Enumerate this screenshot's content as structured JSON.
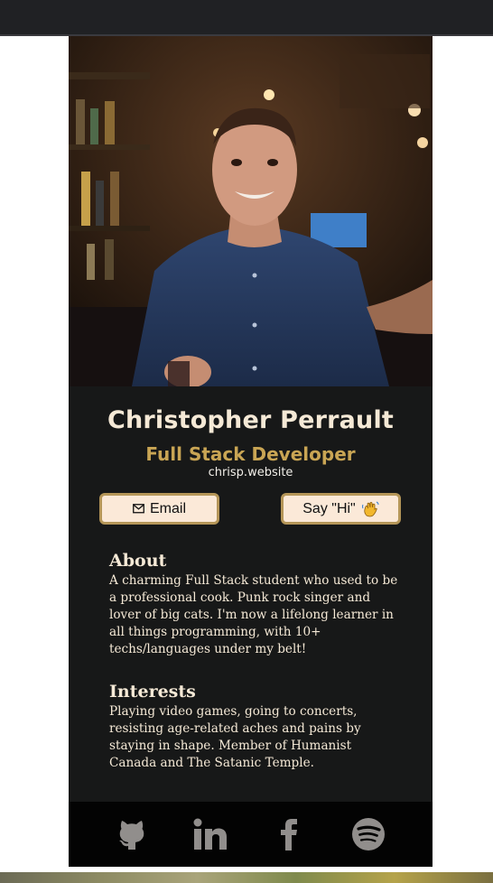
{
  "profile": {
    "name": "Christopher Perrault",
    "title": "Full Stack Developer",
    "website": "chrisp.website",
    "photo_icon": "profile-photo"
  },
  "buttons": {
    "email_label": "Email",
    "email_icon": "mail-icon",
    "hi_label": "Say \"Hi\"",
    "hi_icon": "waving-hand-icon"
  },
  "about": {
    "heading": "About",
    "body": "A charming Full Stack student who used to be a professional cook. Punk rock singer and lover of big cats. I'm now a lifelong learner in all things programming, with 10+ techs/languages under my belt!"
  },
  "interests": {
    "heading": "Interests",
    "body": "Playing video games, going to concerts, resisting age-related aches and pains by staying in shape. Member of Humanist Canada and The Satanic Temple."
  },
  "social": [
    {
      "icon": "github-icon"
    },
    {
      "icon": "linkedin-icon"
    },
    {
      "icon": "facebook-icon"
    },
    {
      "icon": "spotify-icon"
    }
  ],
  "colors": {
    "card_bg": "#171818",
    "accent": "#c9a554",
    "text": "#f5e9d6",
    "button_bg": "#fbe9d8",
    "button_border": "#b59658",
    "footer_bg": "#030303",
    "icon_gray": "#918e8c"
  }
}
